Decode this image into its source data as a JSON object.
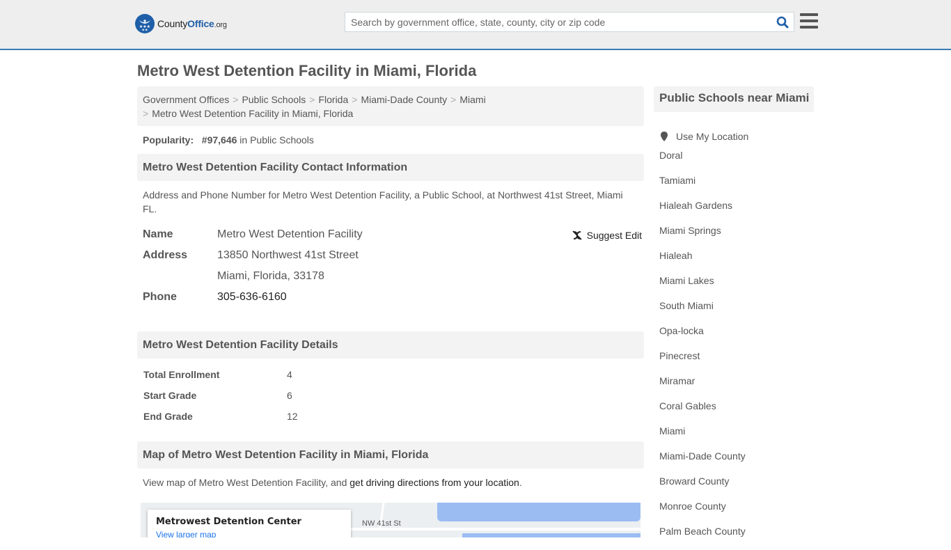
{
  "header": {
    "logo": {
      "name": "County",
      "highlight": "Office",
      "tld": ".org"
    },
    "search": {
      "placeholder": "Search by government office, state, county, city or zip code",
      "value": ""
    }
  },
  "page": {
    "title": "Metro West Detention Facility in Miami, Florida"
  },
  "breadcrumb": [
    "Government Offices",
    "Public Schools",
    "Florida",
    "Miami-Dade County",
    "Miami",
    "Metro West Detention Facility in Miami, Florida"
  ],
  "popularity": {
    "label": "Popularity:",
    "rank": "#97,646",
    "suffix": "in Public Schools"
  },
  "contact": {
    "heading": "Metro West Detention Facility Contact Information",
    "description": "Address and Phone Number for Metro West Detention Facility, a Public School, at Northwest 41st Street, Miami FL.",
    "suggest_edit": "Suggest Edit",
    "name_label": "Name",
    "name": "Metro West Detention Facility",
    "address_label": "Address",
    "address_line1": "13850 Northwest 41st Street",
    "address_line2": "Miami, Florida, 33178",
    "phone_label": "Phone",
    "phone": "305-636-6160"
  },
  "details": {
    "heading": "Metro West Detention Facility Details",
    "rows": [
      {
        "label": "Total Enrollment",
        "value": "4"
      },
      {
        "label": "Start Grade",
        "value": "6"
      },
      {
        "label": "End Grade",
        "value": "12"
      }
    ]
  },
  "map": {
    "heading": "Map of Metro West Detention Facility in Miami, Florida",
    "text_before": "View map of Metro West Detention Facility, and ",
    "link": "get driving directions from your location",
    "text_after": ".",
    "card_title": "Metrowest Detention Center",
    "card_link": "View larger map",
    "street_label": "NW 41st St"
  },
  "sidebar": {
    "heading": "Public Schools near Miami",
    "use_location": "Use My Location",
    "links": [
      "Doral",
      "Tamiami",
      "Hialeah Gardens",
      "Miami Springs",
      "Hialeah",
      "Miami Lakes",
      "South Miami",
      "Opa-locka",
      "Pinecrest",
      "Miramar",
      "Coral Gables",
      "Miami",
      "Miami-Dade County",
      "Broward County",
      "Monroe County",
      "Palm Beach County"
    ]
  },
  "colors": {
    "brand": "#1f5fa8",
    "header_border": "#3a7ab5",
    "header_bg": "#eeeeee",
    "panel_bg": "#f3f3f3",
    "water": "#9bbcf3"
  }
}
